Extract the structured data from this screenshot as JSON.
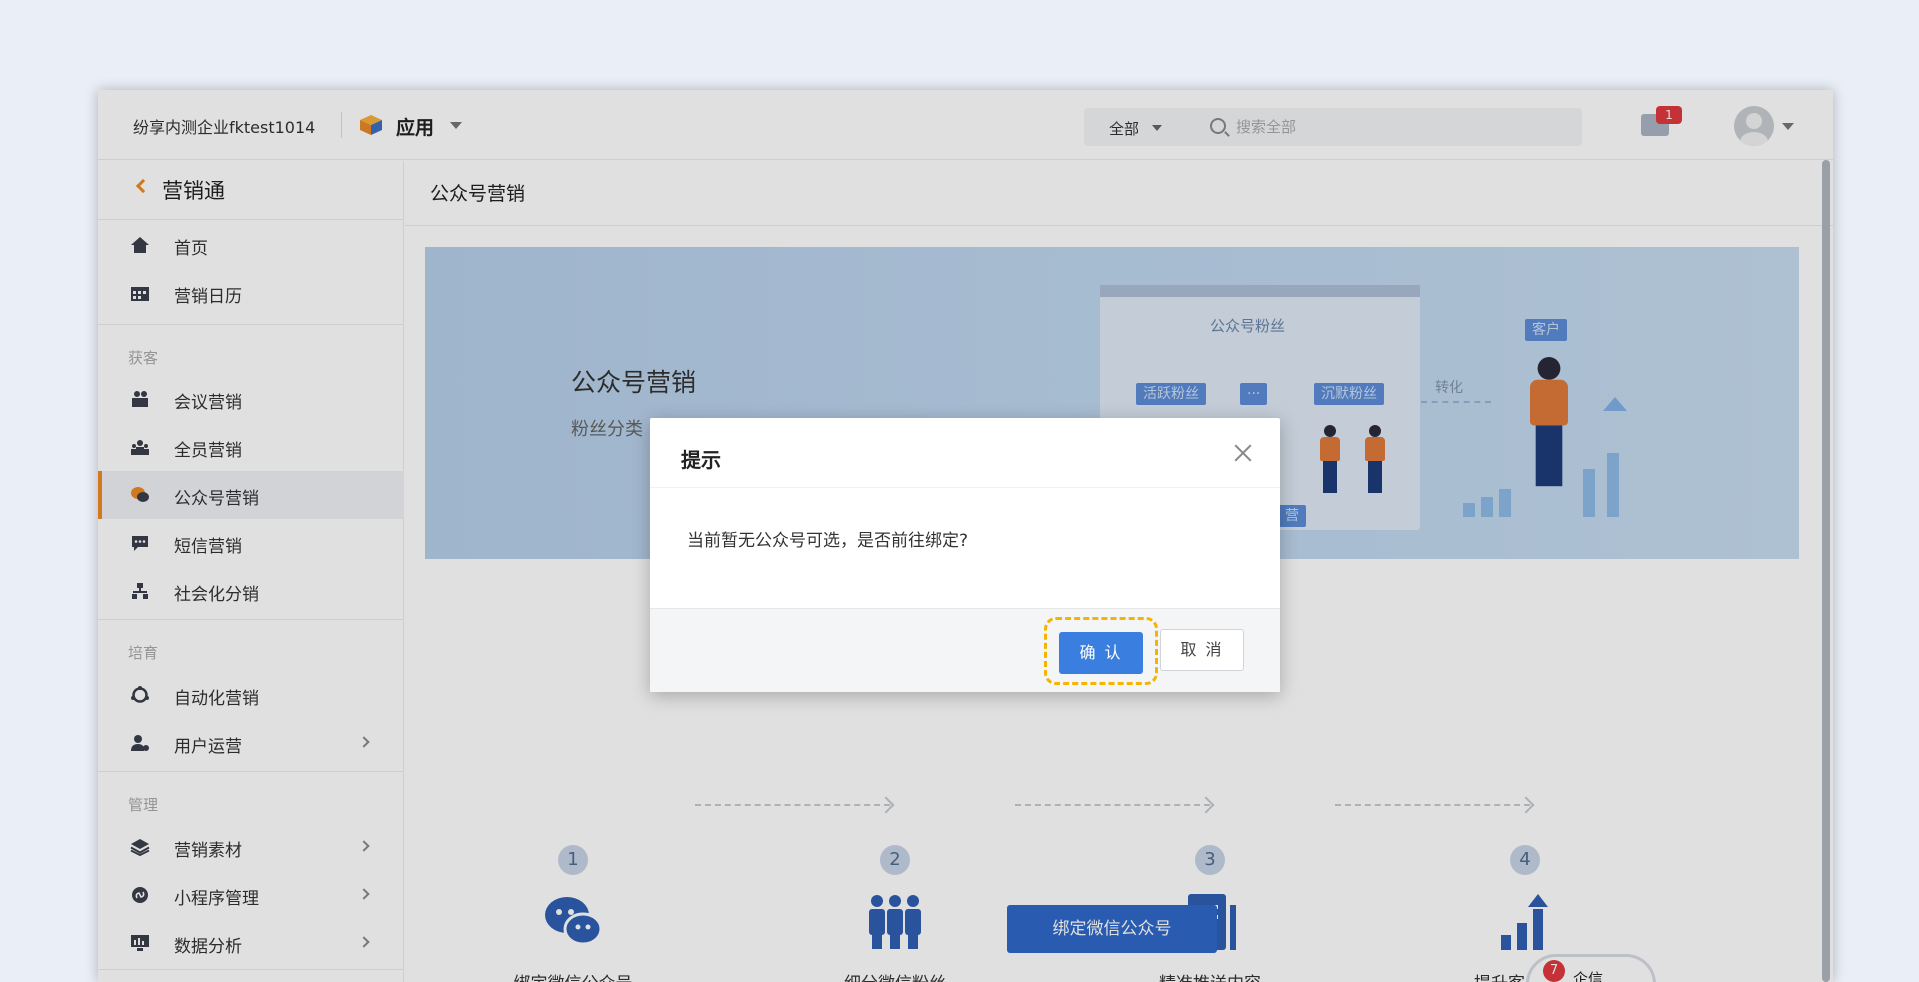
{
  "topbar": {
    "company": "纷享内测企业fktest1014",
    "app_label": "应用",
    "search_scope": "全部",
    "search_placeholder": "搜索全部",
    "mail_badge": "1"
  },
  "sidebar": {
    "back_title": "营销通",
    "items_top": [
      {
        "label": "首页",
        "icon": "home-icon"
      },
      {
        "label": "营销日历",
        "icon": "calendar-icon"
      }
    ],
    "group_acquire": "获客",
    "items_acquire": [
      {
        "label": "会议营销",
        "icon": "meeting-icon"
      },
      {
        "label": "全员营销",
        "icon": "team-icon"
      },
      {
        "label": "公众号营销",
        "icon": "wechat-icon",
        "active": true
      },
      {
        "label": "短信营销",
        "icon": "sms-icon"
      },
      {
        "label": "社会化分销",
        "icon": "hierarchy-icon"
      }
    ],
    "group_nurture": "培育",
    "items_nurture": [
      {
        "label": "自动化营销",
        "icon": "automation-icon"
      },
      {
        "label": "用户运营",
        "icon": "user-ops-icon"
      }
    ],
    "group_manage": "管理",
    "items_manage": [
      {
        "label": "营销素材",
        "icon": "layers-icon"
      },
      {
        "label": "小程序管理",
        "icon": "miniprogram-icon"
      },
      {
        "label": "数据分析",
        "icon": "analytics-icon"
      }
    ]
  },
  "main": {
    "page_title": "公众号营销",
    "banner": {
      "title": "公众号营销",
      "subtitle": "粉丝分类",
      "card_title": "公众号粉丝",
      "tag_active": "活跃粉丝",
      "tag_more": "···",
      "tag_silent": "沉默粉丝",
      "tag_ops": "营",
      "tag_customer": "客户",
      "convert_label": "转化"
    },
    "steps": [
      {
        "num": "1",
        "label": "绑定微信公众号",
        "icon": "wechat-chat-icon"
      },
      {
        "num": "2",
        "label": "细分微信粉丝",
        "icon": "group-people-icon"
      },
      {
        "num": "3",
        "label": "精准推送内容",
        "icon": "document-icon"
      },
      {
        "num": "4",
        "label": "提升客户转化",
        "icon": "growth-chart-icon"
      }
    ],
    "bind_button": "绑定微信公众号",
    "help_badge": "7",
    "help_text": "企信"
  },
  "dialog": {
    "title": "提示",
    "message": "当前暂无公众号可选，是否前往绑定?",
    "confirm": "确 认",
    "cancel": "取 消"
  },
  "colors": {
    "accent_orange": "#f08a24",
    "primary_blue": "#3a7fe0",
    "highlight_yellow": "#f5b400",
    "badge_red": "#e0383e"
  }
}
